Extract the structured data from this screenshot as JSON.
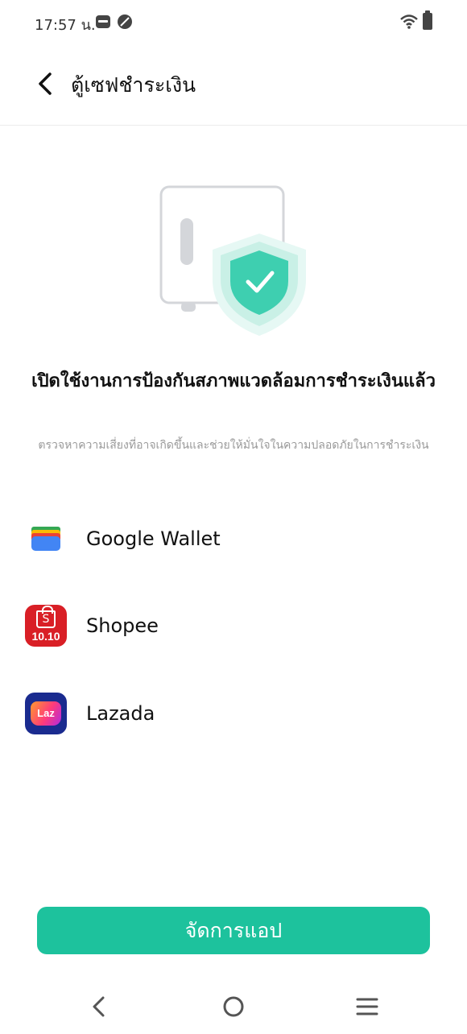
{
  "status_bar": {
    "time": "17:57 น.",
    "icons": [
      "vivo-icon",
      "leaf-icon",
      "wifi-icon",
      "battery-icon"
    ]
  },
  "header": {
    "title": "ตู้เซฟชำระเงิน",
    "back_icon": "chevron-left-icon"
  },
  "main": {
    "illustration": "safe-with-shield-check-icon",
    "headline": "เปิดใช้งานการป้องกันสภาพแวดล้อมการชำระเงินแล้ว",
    "description": "ตรวจหาความเสี่ยงที่อาจเกิดขึ้นและช่วยให้มั่นใจในความปลอดภัยในการชำระเงิน"
  },
  "apps": [
    {
      "name": "Google Wallet",
      "icon": "google-wallet-icon"
    },
    {
      "name": "Shopee",
      "icon": "shopee-icon",
      "badge": "10.10"
    },
    {
      "name": "Lazada",
      "icon": "lazada-icon",
      "badge": "Laz"
    }
  ],
  "actions": {
    "manage_label": "จัดการแอป"
  },
  "nav_bar": {
    "icons": [
      "nav-back-icon",
      "nav-home-icon",
      "nav-menu-icon"
    ]
  },
  "colors": {
    "accent": "#1dc29d",
    "shield": "#3ecfb0",
    "text_primary": "#111111",
    "text_secondary": "#9a9a9a"
  }
}
